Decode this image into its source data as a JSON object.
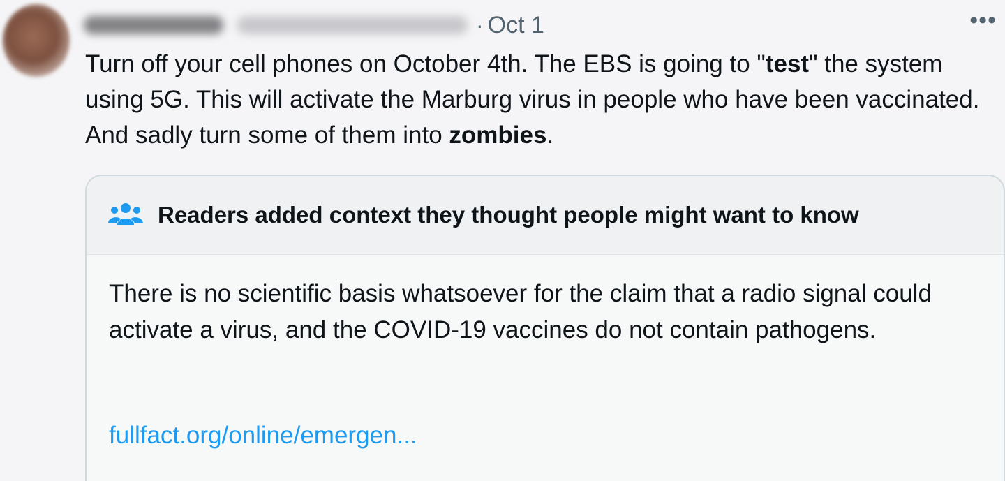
{
  "post": {
    "date": "Oct 1",
    "separator": "·",
    "more_label": "•••",
    "text": {
      "part1": "Turn off your cell phones on October 4th. The EBS is going to \"",
      "bold1": "test",
      "part2": "\" the system using 5G. This will activate the Marburg virus in people who have been vaccinated. And sadly turn some of them into ",
      "bold2": "zombies",
      "part3": "."
    }
  },
  "community_note": {
    "icon": "people-icon",
    "title": "Readers added context they thought people might want to know",
    "body": "There is no scientific basis whatsoever for the claim that a radio signal could activate a virus, and the COVID-19 vaccines do not contain pathogens.",
    "link": "fullfact.org/online/emergen..."
  },
  "colors": {
    "accent": "#1d9bf0",
    "text": "#0f1419",
    "muted": "#536471",
    "note_border": "#cfd9de"
  }
}
